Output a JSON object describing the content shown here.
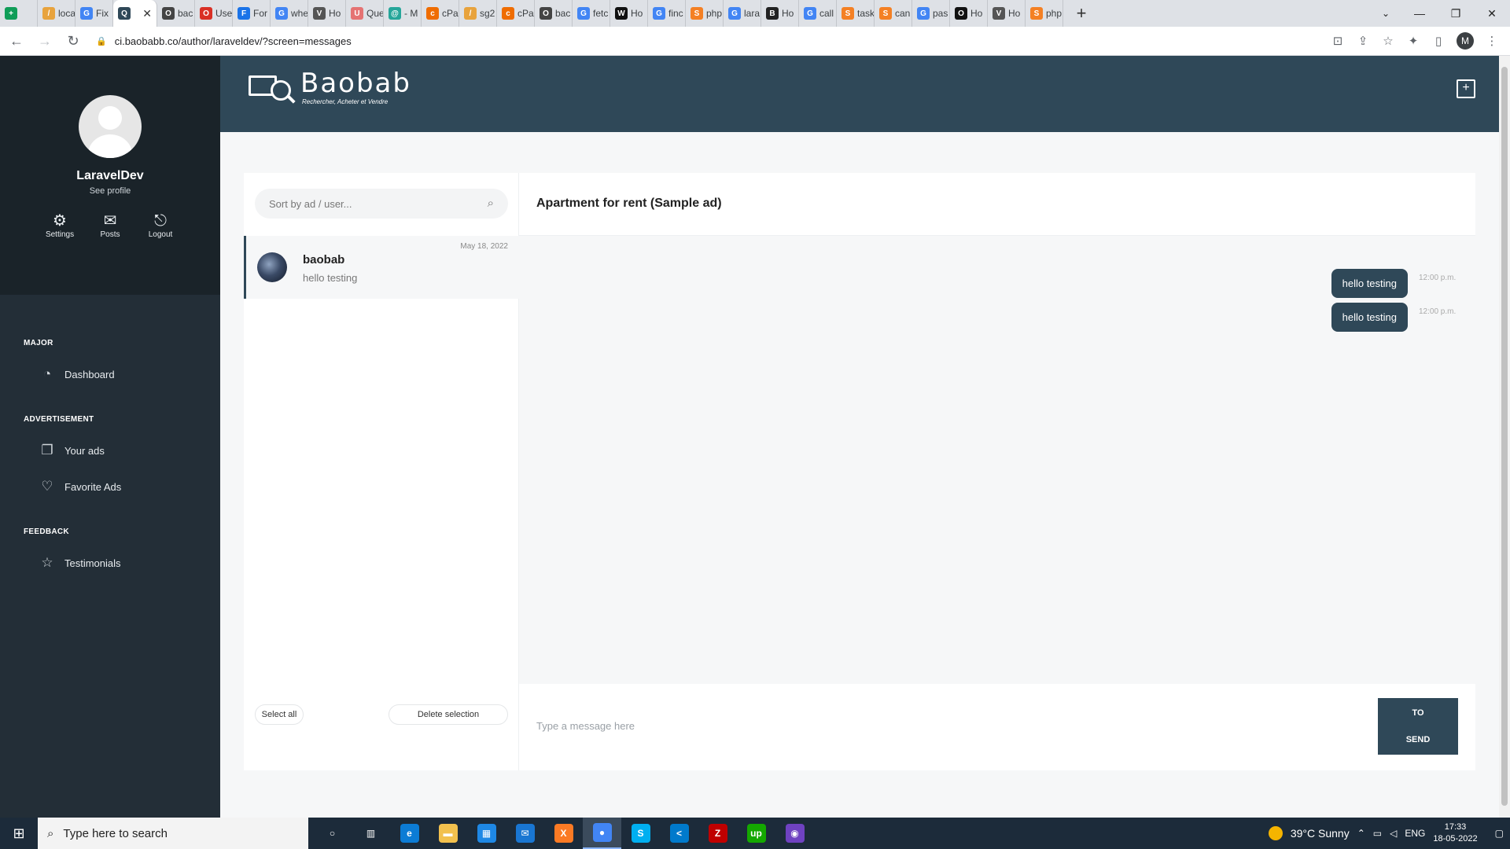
{
  "browser": {
    "tabs": [
      {
        "label": "",
        "color": "#0f9d58",
        "glyph": "+"
      },
      {
        "label": "loca",
        "color": "#e8a33d",
        "glyph": "/"
      },
      {
        "label": "Fix",
        "color": "#4285f4",
        "glyph": "G"
      },
      {
        "label": "",
        "color": "#2f4858",
        "glyph": "Q",
        "active": true
      },
      {
        "label": "bac",
        "color": "#444",
        "glyph": "O"
      },
      {
        "label": "Use",
        "color": "#d93025",
        "glyph": "O"
      },
      {
        "label": "For",
        "color": "#1a73e8",
        "glyph": "F"
      },
      {
        "label": "whe",
        "color": "#4285f4",
        "glyph": "G"
      },
      {
        "label": "Ho",
        "color": "#555",
        "glyph": "V"
      },
      {
        "label": "Que",
        "color": "#e57373",
        "glyph": "U"
      },
      {
        "label": "- M",
        "color": "#26a69a",
        "glyph": "@"
      },
      {
        "label": "cPa",
        "color": "#ef6c00",
        "glyph": "c"
      },
      {
        "label": "sg2",
        "color": "#e8a33d",
        "glyph": "/"
      },
      {
        "label": "cPa",
        "color": "#ef6c00",
        "glyph": "c"
      },
      {
        "label": "bac",
        "color": "#444",
        "glyph": "O"
      },
      {
        "label": "fetc",
        "color": "#4285f4",
        "glyph": "G"
      },
      {
        "label": "Ho",
        "color": "#111",
        "glyph": "W"
      },
      {
        "label": "finc",
        "color": "#4285f4",
        "glyph": "G"
      },
      {
        "label": "php",
        "color": "#f48024",
        "glyph": "S"
      },
      {
        "label": "lara",
        "color": "#4285f4",
        "glyph": "G"
      },
      {
        "label": "Ho",
        "color": "#222",
        "glyph": "B"
      },
      {
        "label": "call",
        "color": "#4285f4",
        "glyph": "G"
      },
      {
        "label": "task",
        "color": "#f48024",
        "glyph": "S"
      },
      {
        "label": "can",
        "color": "#f48024",
        "glyph": "S"
      },
      {
        "label": "pas",
        "color": "#4285f4",
        "glyph": "G"
      },
      {
        "label": "Ho",
        "color": "#111",
        "glyph": "O"
      },
      {
        "label": "Ho",
        "color": "#555",
        "glyph": "V"
      },
      {
        "label": "php",
        "color": "#f48024",
        "glyph": "S"
      }
    ],
    "url": "ci.baobabb.co/author/laraveldev/?screen=messages",
    "profile_initial": "M"
  },
  "sidebar": {
    "username": "LaravelDev",
    "see_profile": "See profile",
    "actions": [
      {
        "label": "Settings",
        "icon": "gear-icon"
      },
      {
        "label": "Posts",
        "icon": "envelope-icon"
      },
      {
        "label": "Logout",
        "icon": "logout-icon"
      }
    ],
    "sections": [
      {
        "title": "MAJOR",
        "items": [
          {
            "label": "Dashboard",
            "icon": "dashboard-icon"
          }
        ]
      },
      {
        "title": "ADVERTISEMENT",
        "items": [
          {
            "label": "Your ads",
            "icon": "copy-icon"
          },
          {
            "label": "Favorite Ads",
            "icon": "heart-icon"
          }
        ]
      },
      {
        "title": "FEEDBACK",
        "items": [
          {
            "label": "Testimonials",
            "icon": "star-icon"
          }
        ]
      }
    ]
  },
  "header": {
    "logo_name": "Baobab",
    "logo_tagline": "Rechercher, Acheter et Vendre"
  },
  "conversations": {
    "search_placeholder": "Sort by ad / user...",
    "items": [
      {
        "name": "baobab",
        "last_message": "hello testing",
        "date": "May 18, 2022"
      }
    ],
    "select_all": "Select all",
    "delete_selection": "Delete selection"
  },
  "chat": {
    "title": "Apartment for rent (Sample ad)",
    "messages": [
      {
        "text": "hello testing",
        "time": "12:00 p.m."
      },
      {
        "text": "hello testing",
        "time": "12:00 p.m."
      }
    ],
    "input_placeholder": "Type a message here",
    "send_line1": "TO",
    "send_line2": "SEND"
  },
  "taskbar": {
    "search_placeholder": "Type here to search",
    "weather": "39°C  Sunny",
    "lang": "ENG",
    "time": "17:33",
    "date": "18-05-2022",
    "apps": [
      {
        "name": "cortana",
        "color": "transparent",
        "glyph": "○"
      },
      {
        "name": "task-view",
        "color": "transparent",
        "glyph": "▥"
      },
      {
        "name": "edge",
        "color": "#0c7cd5",
        "glyph": "e"
      },
      {
        "name": "file-explorer",
        "color": "#f2c14e",
        "glyph": "▬"
      },
      {
        "name": "store",
        "color": "#1e88e5",
        "glyph": "▦"
      },
      {
        "name": "mail",
        "color": "#1976d2",
        "glyph": "✉"
      },
      {
        "name": "xampp",
        "color": "#fb7a24",
        "glyph": "X"
      },
      {
        "name": "chrome",
        "color": "#4285f4",
        "glyph": "●",
        "active": true
      },
      {
        "name": "skype",
        "color": "#00aff0",
        "glyph": "S"
      },
      {
        "name": "vscode",
        "color": "#007acc",
        "glyph": "<"
      },
      {
        "name": "filezilla",
        "color": "#bf0000",
        "glyph": "Z"
      },
      {
        "name": "upwork",
        "color": "#14a800",
        "glyph": "up"
      },
      {
        "name": "github-desktop",
        "color": "#6f42c1",
        "glyph": "◉"
      }
    ]
  }
}
